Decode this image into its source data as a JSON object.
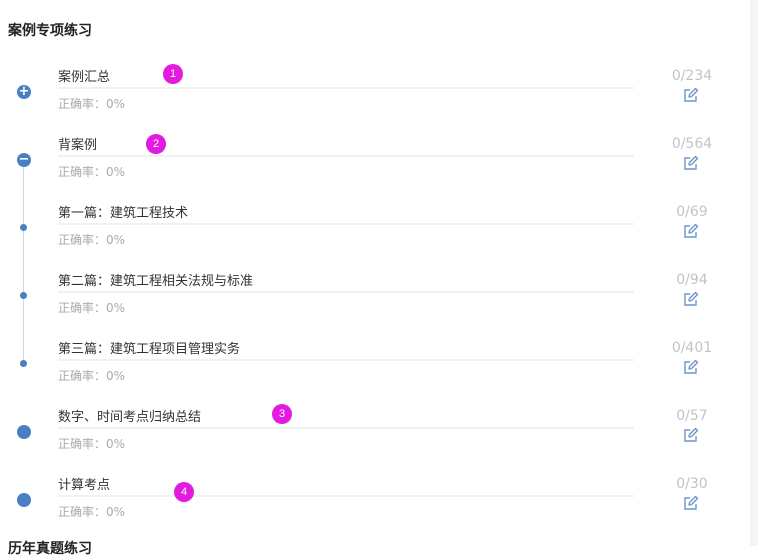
{
  "section": {
    "title": "案例专项练习",
    "next_title": "历年真题练习"
  },
  "items": [
    {
      "title": "案例汇总",
      "accuracy": "正确率：0%",
      "count": "0/234",
      "marker": "plus",
      "badge": "1"
    },
    {
      "title": "背案例",
      "accuracy": "正确率：0%",
      "count": "0/564",
      "marker": "minus",
      "badge": "2"
    },
    {
      "title": "第一篇：建筑工程技术",
      "accuracy": "正确率：0%",
      "count": "0/69",
      "marker": "small",
      "badge": ""
    },
    {
      "title": "第二篇：建筑工程相关法规与标准",
      "accuracy": "正确率：0%",
      "count": "0/94",
      "marker": "small",
      "badge": ""
    },
    {
      "title": "第三篇：建筑工程项目管理实务",
      "accuracy": "正确率：0%",
      "count": "0/401",
      "marker": "small",
      "badge": ""
    },
    {
      "title": "数字、时间考点归纳总结",
      "accuracy": "正确率：0%",
      "count": "0/57",
      "marker": "big",
      "badge": "3"
    },
    {
      "title": "计算考点",
      "accuracy": "正确率：0%",
      "count": "0/30",
      "marker": "big",
      "badge": "4"
    }
  ],
  "icons": {
    "plus": "plus-icon",
    "minus": "minus-icon",
    "edit": "edit-icon"
  },
  "colors": {
    "accent": "#4a7fc1",
    "badge": "#e31be0",
    "count": "#c0c4ca"
  }
}
